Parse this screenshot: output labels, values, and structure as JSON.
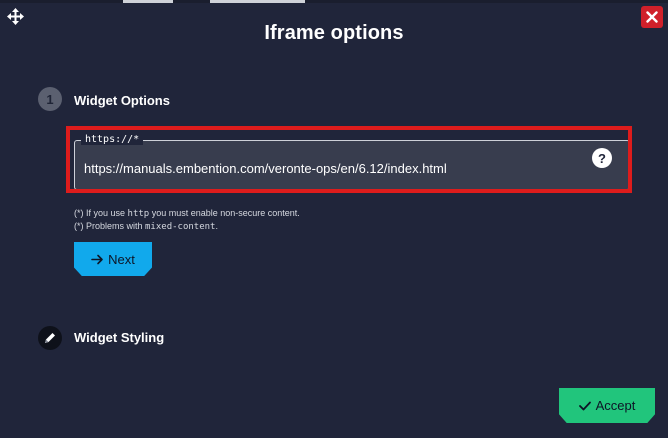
{
  "dialog": {
    "title": "Iframe options",
    "close_icon": "close-icon",
    "move_icon": "move-icon"
  },
  "step1": {
    "number": "1",
    "title": "Widget Options",
    "url_field": {
      "legend": "https://*",
      "value": "https://manuals.embention.com/veronte-ops/en/6.12/index.html",
      "help": "?"
    },
    "notes": [
      {
        "before": "(*) If you use ",
        "code": "http",
        "after": " you must enable non-secure content."
      },
      {
        "before": "(*) Problems with ",
        "code": "mixed-content",
        "after": "."
      }
    ],
    "next_label": "Next"
  },
  "step2": {
    "title": "Widget Styling",
    "icon": "pen-icon"
  },
  "footer": {
    "accept_label": "Accept"
  },
  "colors": {
    "background": "#20253a",
    "highlight": "#dd1c1c",
    "next": "#11a9ec",
    "accept": "#21c57c",
    "close": "#d0202a"
  }
}
